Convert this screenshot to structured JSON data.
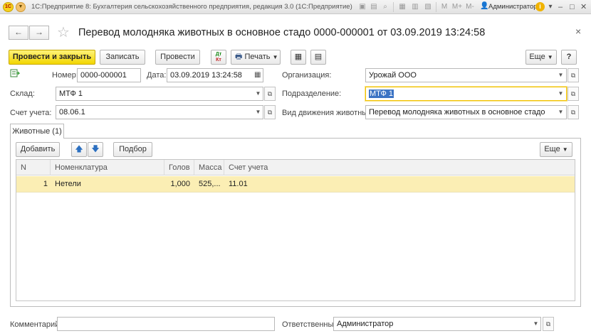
{
  "window": {
    "logo_text": "1C",
    "app_title": "1С:Предприятие 8: Бухгалтерия сельскохозяйственного предприятия, редакция 3.0 (1С:Предприятие)",
    "toolbar_icons": [
      "save-icon",
      "print-icon",
      "search-icon",
      "calendar-icon",
      "calculator-icon"
    ],
    "memory_buttons": [
      "M",
      "M+",
      "M-"
    ],
    "user_name": "Администратор",
    "info_label": "i",
    "minimize": "–",
    "maximize": "□",
    "close": "✕"
  },
  "form": {
    "back": "←",
    "forward": "→",
    "title": "Перевод молодняка животных в основное стадо 0000-000001 от 03.09.2019 13:24:58",
    "close": "×"
  },
  "command_bar": {
    "post_and_close": "Провести и закрыть",
    "save": "Записать",
    "post": "Провести",
    "dt_kt_dt": "Дт",
    "dt_kt_kt": "Кт",
    "print": "Печать",
    "more": "Еще",
    "help": "?"
  },
  "fields": {
    "number_label": "Номер:",
    "number_value": "0000-000001",
    "date_label": "Дата:",
    "date_value": "03.09.2019 13:24:58",
    "organization_label": "Организация:",
    "organization_value": "Урожай ООО",
    "warehouse_label": "Склад:",
    "warehouse_value": "МТФ 1",
    "division_label": "Подразделение:",
    "division_value": "МТФ 1",
    "account_label": "Счет учета:",
    "account_value": "08.06.1",
    "movement_label": "Вид движения животных:",
    "movement_value": "Перевод молодняка животных в основное стадо"
  },
  "tabs": [
    {
      "label": "Животные (1)"
    }
  ],
  "table_toolbar": {
    "add": "Добавить",
    "select": "Подбор",
    "more": "Еще"
  },
  "table": {
    "columns": [
      "N",
      "Номенклатура",
      "Голов",
      "Масса",
      "Счет учета"
    ],
    "rows": [
      {
        "n": "1",
        "item": "Нетели",
        "heads": "1,000",
        "mass": "525,...",
        "account": "11.01"
      }
    ]
  },
  "footer": {
    "comment_label": "Комментарий:",
    "comment_value": "",
    "responsible_label": "Ответственный:",
    "responsible_value": "Администратор"
  },
  "colors": {
    "primary_button": "#f2d600",
    "selected_row": "#fbeeb4",
    "focus_border": "#f2c200",
    "selection": "#3b73c4"
  }
}
